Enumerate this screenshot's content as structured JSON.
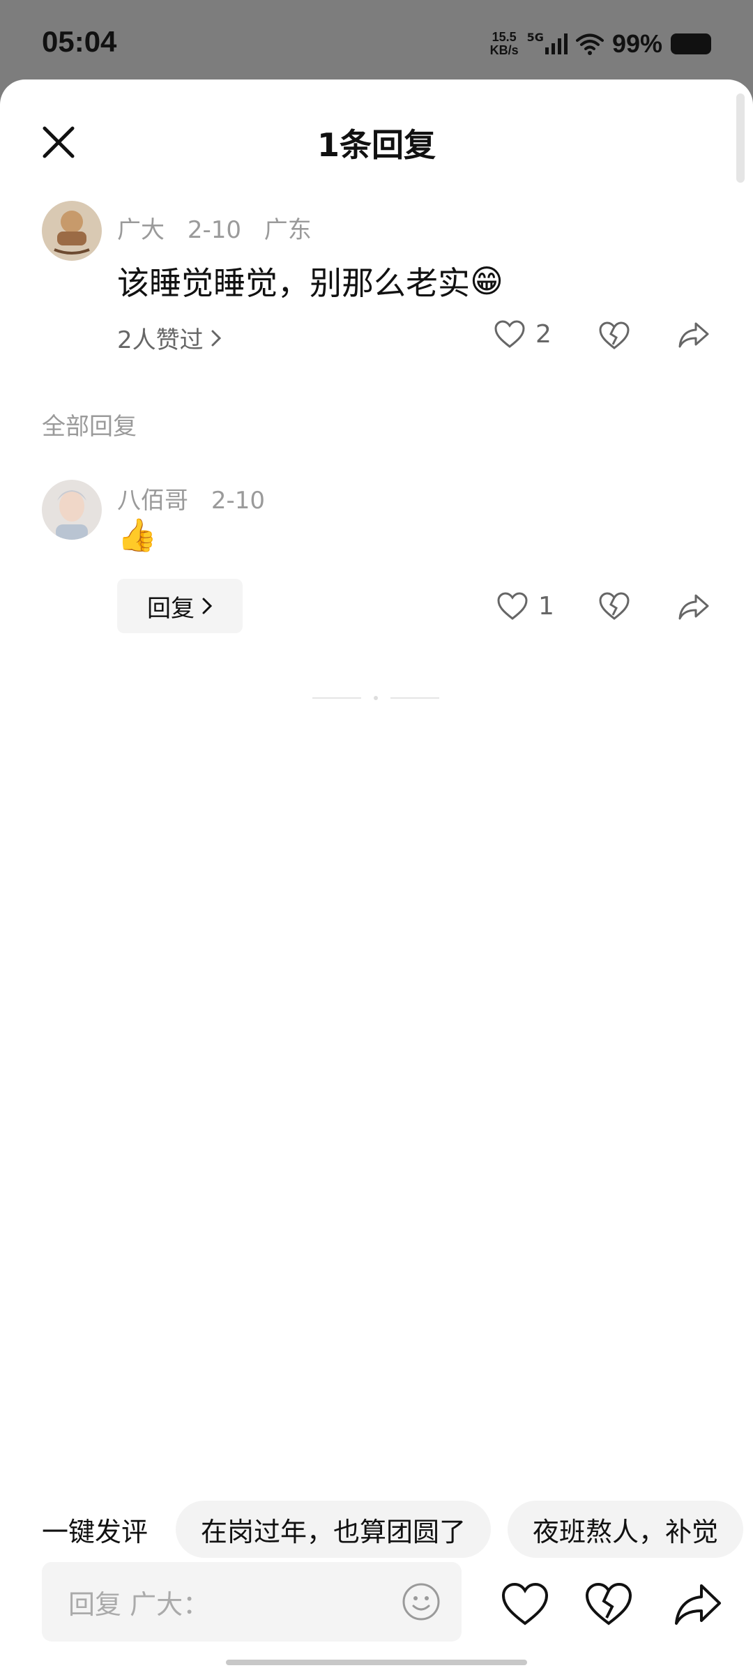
{
  "status_bar": {
    "time": "05:04",
    "net_speed_value": "15.5",
    "net_speed_unit": "KB/s",
    "network": "5G",
    "battery": "99%"
  },
  "sheet": {
    "title": "1条回复"
  },
  "main_comment": {
    "author": "广大",
    "date": "2-10",
    "location": "广东",
    "text": "该睡觉睡觉，别那么老实",
    "emoji": "😁",
    "likers": "2人赞过",
    "like_count": "2"
  },
  "replies_section": {
    "label": "全部回复"
  },
  "reply": {
    "author": "八佰哥",
    "date": "2-10",
    "emoji": "👍",
    "reply_button": "回复",
    "like_count": "1"
  },
  "quick_comments": {
    "label": "一键发评",
    "chips": [
      "在岗过年，也算团圆了",
      "夜班熬人，补觉"
    ]
  },
  "input": {
    "placeholder": "回复 广大："
  },
  "colors": {
    "overlay": "#7d7d7d",
    "sheet_bg": "#ffffff",
    "muted_text": "#9a9a9a",
    "chip_bg": "#f3f3f3"
  }
}
